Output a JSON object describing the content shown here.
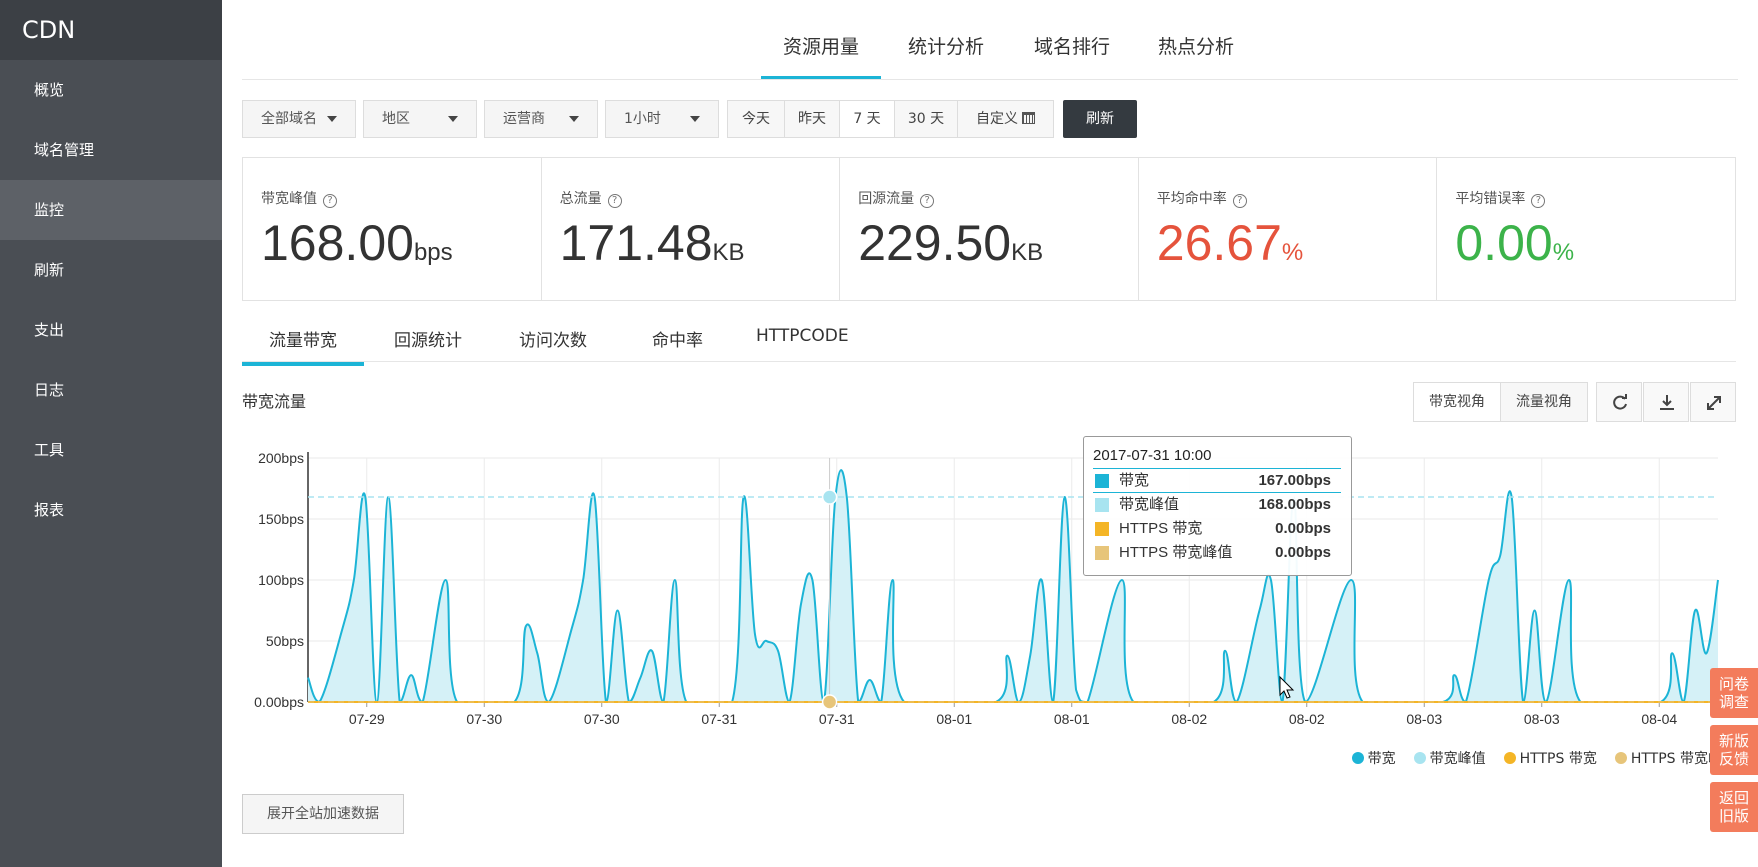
{
  "sidebar": {
    "brand": "CDN",
    "items": [
      {
        "label": "概览"
      },
      {
        "label": "域名管理"
      },
      {
        "label": "监控"
      },
      {
        "label": "刷新"
      },
      {
        "label": "支出"
      },
      {
        "label": "日志"
      },
      {
        "label": "工具"
      },
      {
        "label": "报表"
      }
    ],
    "active_index": 2
  },
  "top_tabs": [
    {
      "label": "资源用量"
    },
    {
      "label": "统计分析"
    },
    {
      "label": "域名排行"
    },
    {
      "label": "热点分析"
    }
  ],
  "filters": {
    "domain": "全部域名",
    "region": "地区",
    "isp": "运营商",
    "interval": "1小时",
    "ranges": [
      "今天",
      "昨天",
      "7 天",
      "30 天",
      "自定义"
    ],
    "active_range": "7 天",
    "refresh_label": "刷新"
  },
  "stats": [
    {
      "label": "带宽峰值",
      "value": "168.00",
      "unit": "bps",
      "color": "#333333"
    },
    {
      "label": "总流量",
      "value": "171.48",
      "unit": "KB",
      "color": "#333333"
    },
    {
      "label": "回源流量",
      "value": "229.50",
      "unit": "KB",
      "color": "#333333"
    },
    {
      "label": "平均命中率",
      "value": "26.67",
      "unit": "%",
      "color": "#e5533c"
    },
    {
      "label": "平均错误率",
      "value": "0.00",
      "unit": "%",
      "color": "#3cb34a"
    }
  ],
  "sub_tabs": [
    {
      "label": "流量带宽"
    },
    {
      "label": "回源统计"
    },
    {
      "label": "访问次数"
    },
    {
      "label": "命中率"
    },
    {
      "label": "HTTPCODE"
    }
  ],
  "chart_section": {
    "title": "带宽流量",
    "views": [
      "带宽视角",
      "流量视角"
    ],
    "active_view": "带宽视角"
  },
  "chart_data": {
    "type": "area",
    "ylim": [
      0,
      200
    ],
    "y_ticks": [
      "0.00bps",
      "50bps",
      "100bps",
      "150bps",
      "200bps"
    ],
    "x_tick_labels": [
      "07-29",
      "07-30",
      "07-30",
      "07-31",
      "07-31",
      "08-01",
      "08-01",
      "08-02",
      "08-02",
      "08-03",
      "08-03",
      "08-04"
    ],
    "x_count": 124,
    "peak_line": 168,
    "highlight_index": 45,
    "series": [
      {
        "name": "带宽",
        "color": "#1cb4d6",
        "fill": "#d5f1f7",
        "points": [
          [
            0,
            20
          ],
          [
            1,
            0
          ],
          [
            3,
            60
          ],
          [
            4,
            100
          ],
          [
            5,
            168
          ],
          [
            6,
            0
          ],
          [
            7,
            168
          ],
          [
            8,
            0
          ],
          [
            9,
            22
          ],
          [
            10,
            0
          ],
          [
            12,
            100
          ],
          [
            13,
            0
          ],
          [
            18,
            0
          ],
          [
            19,
            62
          ],
          [
            20,
            40
          ],
          [
            21,
            0
          ],
          [
            23,
            60
          ],
          [
            24,
            100
          ],
          [
            25,
            168
          ],
          [
            26,
            0
          ],
          [
            27,
            75
          ],
          [
            28,
            0
          ],
          [
            29,
            20
          ],
          [
            30,
            42
          ],
          [
            31,
            0
          ],
          [
            32,
            100
          ],
          [
            33,
            0
          ],
          [
            37,
            0
          ],
          [
            38,
            168
          ],
          [
            39,
            55
          ],
          [
            40,
            50
          ],
          [
            41,
            42
          ],
          [
            42,
            0
          ],
          [
            43,
            80
          ],
          [
            44,
            100
          ],
          [
            45,
            0
          ],
          [
            46,
            167
          ],
          [
            47,
            168
          ],
          [
            48,
            0
          ],
          [
            49,
            18
          ],
          [
            50,
            0
          ],
          [
            51,
            100
          ],
          [
            52,
            0
          ],
          [
            60,
            0
          ],
          [
            61,
            38
          ],
          [
            62,
            0
          ],
          [
            63,
            38
          ],
          [
            64,
            100
          ],
          [
            65,
            0
          ],
          [
            66,
            168
          ],
          [
            67,
            10
          ],
          [
            68,
            0
          ],
          [
            71,
            100
          ],
          [
            72,
            0
          ],
          [
            79,
            0
          ],
          [
            80,
            42
          ],
          [
            81,
            0
          ],
          [
            83,
            75
          ],
          [
            84,
            100
          ],
          [
            85,
            0
          ],
          [
            86,
            168
          ],
          [
            87,
            0
          ],
          [
            91,
            100
          ],
          [
            92,
            0
          ],
          [
            99,
            0
          ],
          [
            100,
            22
          ],
          [
            101,
            0
          ],
          [
            103,
            100
          ],
          [
            104,
            120
          ],
          [
            105,
            168
          ],
          [
            106,
            0
          ],
          [
            107,
            75
          ],
          [
            108,
            0
          ],
          [
            110,
            100
          ],
          [
            111,
            0
          ],
          [
            118,
            0
          ],
          [
            119,
            40
          ],
          [
            120,
            0
          ],
          [
            121,
            75
          ],
          [
            122,
            40
          ],
          [
            123,
            100
          ]
        ]
      },
      {
        "name": "带宽峰值",
        "color": "#a8e4f0"
      },
      {
        "name": "HTTPS 带宽",
        "color": "#f4b526"
      },
      {
        "name": "HTTPS 带宽峰值",
        "color": "#e7c57a"
      }
    ]
  },
  "tooltip": {
    "title": "2017-07-31 10:00",
    "rows": [
      {
        "name": "带宽",
        "value": "167.00bps",
        "color": "#1cb4d6"
      },
      {
        "name": "带宽峰值",
        "value": "168.00bps",
        "color": "#a8e4f0"
      },
      {
        "name": "HTTPS 带宽",
        "value": "0.00bps",
        "color": "#f4b526"
      },
      {
        "name": "HTTPS 带宽峰值",
        "value": "0.00bps",
        "color": "#e7c57a"
      }
    ]
  },
  "expand_label": "展开全站加速数据",
  "side_buttons": [
    "问卷\n调查",
    "新版\n反馈",
    "返回\n旧版"
  ]
}
